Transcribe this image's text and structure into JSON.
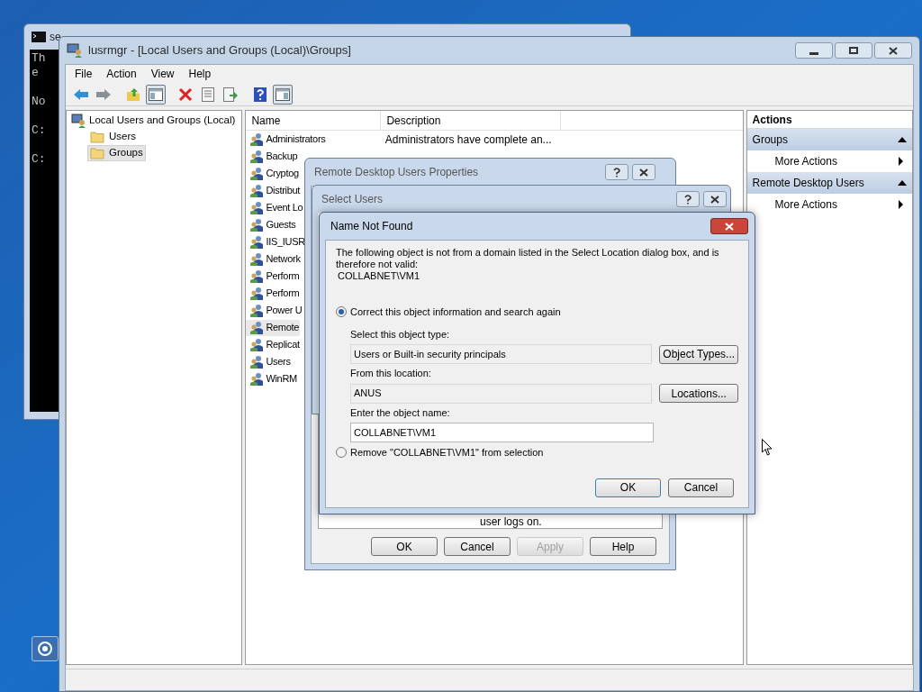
{
  "console": {
    "title": "se",
    "lines": [
      "Th",
      "e",
      "No",
      "C:",
      "C:"
    ]
  },
  "mmc": {
    "title": "lusrmgr - [Local Users and Groups (Local)\\Groups]",
    "menu": [
      "File",
      "Action",
      "View",
      "Help"
    ],
    "toolbar": [
      {
        "kind": "back",
        "pressed": false
      },
      {
        "kind": "forward",
        "pressed": false
      },
      {
        "kind": "up",
        "pressed": false
      },
      {
        "kind": "tree",
        "pressed": true
      },
      {
        "kind": "delete",
        "pressed": false
      },
      {
        "kind": "properties",
        "pressed": false
      },
      {
        "kind": "export",
        "pressed": false
      },
      {
        "kind": "help",
        "pressed": false
      },
      {
        "kind": "panel",
        "pressed": true
      }
    ],
    "tree": {
      "label": "Local Users and Groups (Local)",
      "children": [
        {
          "label": "Users",
          "selected": false
        },
        {
          "label": "Groups",
          "selected": true
        }
      ]
    },
    "list": {
      "columns": [
        "Name",
        "Description"
      ],
      "rows": [
        {
          "name": "Administrators",
          "description": "Administrators have complete an...",
          "selected": false
        },
        {
          "name": "Backup",
          "selected": false
        },
        {
          "name": "Cryptog",
          "selected": false
        },
        {
          "name": "Distribut",
          "selected": false
        },
        {
          "name": "Event Lo",
          "selected": false
        },
        {
          "name": "Guests",
          "selected": false
        },
        {
          "name": "IIS_IUSR",
          "selected": false
        },
        {
          "name": "Network",
          "selected": false
        },
        {
          "name": "Perform",
          "selected": false
        },
        {
          "name": "Perform",
          "selected": false
        },
        {
          "name": "Power U",
          "selected": false
        },
        {
          "name": "Remote",
          "selected": true
        },
        {
          "name": "Replicat",
          "selected": false
        },
        {
          "name": "Users",
          "selected": false
        },
        {
          "name": "WinRM",
          "selected": false
        }
      ]
    },
    "actions": {
      "title": "Actions",
      "sections": [
        {
          "title": "Groups",
          "items": [
            "More Actions"
          ]
        },
        {
          "title": "Remote Desktop Users",
          "items": [
            "More Actions"
          ]
        }
      ]
    }
  },
  "properties_dialog": {
    "title": "Remote Desktop Users Properties",
    "text": "user logs on.",
    "buttons": [
      {
        "label": "OK",
        "disabled": false
      },
      {
        "label": "Cancel",
        "disabled": false
      },
      {
        "label": "Apply",
        "disabled": true
      },
      {
        "label": "Help",
        "disabled": false
      }
    ]
  },
  "select_users_dialog": {
    "title": "Select Users"
  },
  "name_not_found_dialog": {
    "title": "Name Not Found",
    "message": "The following object is not from a domain listed in the Select Location dialog box, and is therefore not valid:",
    "object": "COLLABNET\\VM1",
    "options": [
      {
        "label": "Correct this object information and search again",
        "selected": true
      },
      {
        "label": "Remove \"COLLABNET\\VM1\" from selection",
        "selected": false
      }
    ],
    "object_type": {
      "label": "Select this object type:",
      "value": "Users or Built-in security principals",
      "button": "Object Types..."
    },
    "location": {
      "label": "From this location:",
      "value": "ANUS",
      "button": "Locations..."
    },
    "object_name": {
      "label": "Enter the object name:",
      "value": "COLLABNET\\VM1"
    },
    "buttons": [
      {
        "label": "OK",
        "default": true
      },
      {
        "label": "Cancel",
        "default": false
      }
    ]
  }
}
